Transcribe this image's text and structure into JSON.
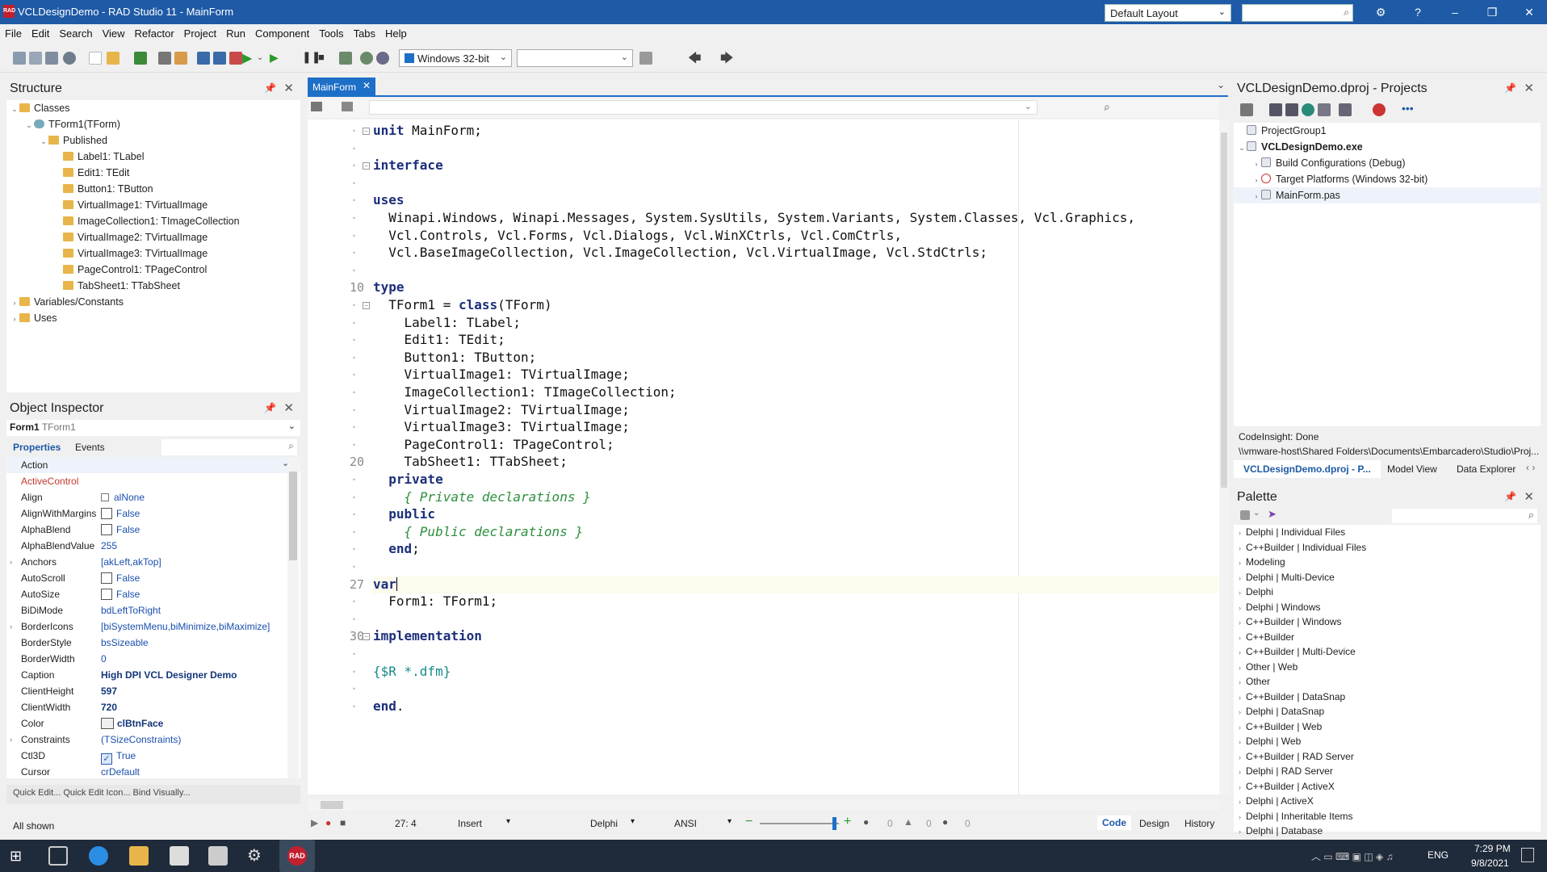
{
  "window": {
    "title": "VCLDesignDemo - RAD Studio 11 - MainForm",
    "logo_text": "RAD",
    "layout": "Default Layout"
  },
  "menu": [
    "File",
    "Edit",
    "Search",
    "View",
    "Refactor",
    "Project",
    "Run",
    "Component",
    "Tools",
    "Tabs",
    "Help"
  ],
  "toolbar": {
    "platform": "Windows 32-bit"
  },
  "structure": {
    "title": "Structure",
    "nodes": [
      {
        "label": "Classes",
        "depth": 0,
        "exp": "⌄"
      },
      {
        "label": "TForm1(TForm)",
        "depth": 1,
        "exp": "⌄"
      },
      {
        "label": "Published",
        "depth": 2,
        "exp": "⌄"
      },
      {
        "label": "Label1: TLabel",
        "depth": 3,
        "exp": ""
      },
      {
        "label": "Edit1: TEdit",
        "depth": 3,
        "exp": ""
      },
      {
        "label": "Button1: TButton",
        "depth": 3,
        "exp": ""
      },
      {
        "label": "VirtualImage1: TVirtualImage",
        "depth": 3,
        "exp": ""
      },
      {
        "label": "ImageCollection1: TImageCollection",
        "depth": 3,
        "exp": ""
      },
      {
        "label": "VirtualImage2: TVirtualImage",
        "depth": 3,
        "exp": ""
      },
      {
        "label": "VirtualImage3: TVirtualImage",
        "depth": 3,
        "exp": ""
      },
      {
        "label": "PageControl1: TPageControl",
        "depth": 3,
        "exp": ""
      },
      {
        "label": "TabSheet1: TTabSheet",
        "depth": 3,
        "exp": ""
      },
      {
        "label": "Variables/Constants",
        "depth": 0,
        "exp": "›"
      },
      {
        "label": "Uses",
        "depth": 0,
        "exp": "›"
      }
    ]
  },
  "inspector": {
    "title": "Object Inspector",
    "object_name": "Form1",
    "object_type": "TForm1",
    "tabs": [
      "Properties",
      "Events"
    ],
    "props": [
      {
        "name": "Action",
        "value": "",
        "kind": "text"
      },
      {
        "name": "ActiveControl",
        "value": "",
        "kind": "text",
        "red": true
      },
      {
        "name": "Align",
        "value": "alNone",
        "kind": "text"
      },
      {
        "name": "AlignWithMargins",
        "value": "False",
        "kind": "cb"
      },
      {
        "name": "AlphaBlend",
        "value": "False",
        "kind": "cb"
      },
      {
        "name": "AlphaBlendValue",
        "value": "255",
        "kind": "text"
      },
      {
        "name": "Anchors",
        "value": "[akLeft,akTop]",
        "kind": "text",
        "arrow": true
      },
      {
        "name": "AutoScroll",
        "value": "False",
        "kind": "cb"
      },
      {
        "name": "AutoSize",
        "value": "False",
        "kind": "cb"
      },
      {
        "name": "BiDiMode",
        "value": "bdLeftToRight",
        "kind": "text"
      },
      {
        "name": "BorderIcons",
        "value": "[biSystemMenu,biMinimize,biMaximize]",
        "kind": "text",
        "arrow": true
      },
      {
        "name": "BorderStyle",
        "value": "bsSizeable",
        "kind": "text"
      },
      {
        "name": "BorderWidth",
        "value": "0",
        "kind": "text"
      },
      {
        "name": "Caption",
        "value": "High DPI VCL Designer Demo",
        "kind": "bold"
      },
      {
        "name": "ClientHeight",
        "value": "597",
        "kind": "bold"
      },
      {
        "name": "ClientWidth",
        "value": "720",
        "kind": "bold"
      },
      {
        "name": "Color",
        "value": "clBtnFace",
        "kind": "color"
      },
      {
        "name": "Constraints",
        "value": "(TSizeConstraints)",
        "kind": "text",
        "arrow": true
      },
      {
        "name": "Ctl3D",
        "value": "True",
        "kind": "cbchk"
      },
      {
        "name": "Cursor",
        "value": "crDefault",
        "kind": "text"
      }
    ],
    "quick_edit": "Quick Edit... Quick Edit Icon... Bind Visually...",
    "all_shown": "All shown"
  },
  "editor": {
    "tab": "MainForm",
    "lines": [
      {
        "n": "",
        "html": "<span class='kw'>unit</span> MainForm;",
        "fold": "⊟"
      },
      {
        "n": "",
        "html": ""
      },
      {
        "n": "",
        "html": "<span class='kw'>interface</span>",
        "fold": "⊟"
      },
      {
        "n": "",
        "html": ""
      },
      {
        "n": "",
        "html": "<span class='kw'>uses</span>"
      },
      {
        "n": "",
        "html": "  Winapi.Windows, Winapi.Messages, System.SysUtils, System.Variants, System.Classes, Vcl.Graphics,"
      },
      {
        "n": "",
        "html": "  Vcl.Controls, Vcl.Forms, Vcl.Dialogs, Vcl.WinXCtrls, Vcl.ComCtrls,"
      },
      {
        "n": "",
        "html": "  Vcl.BaseImageCollection, Vcl.ImageCollection, Vcl.VirtualImage, Vcl.StdCtrls;"
      },
      {
        "n": "",
        "html": ""
      },
      {
        "n": "10",
        "html": "<span class='kw'>type</span>"
      },
      {
        "n": "",
        "html": "  TForm1 = <span class='kw'>class</span>(TForm)",
        "fold": "⊟"
      },
      {
        "n": "",
        "html": "    Label1: TLabel;"
      },
      {
        "n": "",
        "html": "    Edit1: TEdit;"
      },
      {
        "n": "",
        "html": "    Button1: TButton;"
      },
      {
        "n": "",
        "html": "    VirtualImage1: TVirtualImage;"
      },
      {
        "n": "",
        "html": "    ImageCollection1: TImageCollection;"
      },
      {
        "n": "",
        "html": "    VirtualImage2: TVirtualImage;"
      },
      {
        "n": "",
        "html": "    VirtualImage3: TVirtualImage;"
      },
      {
        "n": "",
        "html": "    PageControl1: TPageControl;"
      },
      {
        "n": "20",
        "html": "    TabSheet1: TTabSheet;"
      },
      {
        "n": "",
        "html": "  <span class='kw'>private</span>"
      },
      {
        "n": "",
        "html": "    <span class='cm'>{ Private declarations }</span>"
      },
      {
        "n": "",
        "html": "  <span class='kw'>public</span>"
      },
      {
        "n": "",
        "html": "    <span class='cm'>{ Public declarations }</span>"
      },
      {
        "n": "",
        "html": "  <span class='kw'>end</span>;"
      },
      {
        "n": "",
        "html": ""
      },
      {
        "n": "27",
        "html": "<span class='kw'>var</span>",
        "cur": true
      },
      {
        "n": "",
        "html": "  Form1: TForm1;"
      },
      {
        "n": "",
        "html": ""
      },
      {
        "n": "30",
        "html": "<span class='kw'>implementation</span>",
        "fold": "⊟"
      },
      {
        "n": "",
        "html": ""
      },
      {
        "n": "",
        "html": "<span class='dr'>{$R *.dfm}</span>"
      },
      {
        "n": "",
        "html": ""
      },
      {
        "n": "",
        "html": "<span class='kw'>end</span>."
      }
    ],
    "status": {
      "pos": "27:  4",
      "mode": "Insert",
      "lang": "Delphi",
      "enc": "ANSI",
      "c1": "0",
      "c2": "0",
      "c3": "0"
    },
    "views": [
      "Code",
      "Design",
      "History"
    ]
  },
  "projects": {
    "title": "VCLDesignDemo.dproj - Projects",
    "nodes": [
      {
        "label": "ProjectGroup1",
        "depth": 0,
        "exp": "",
        "bold": false
      },
      {
        "label": "VCLDesignDemo.exe",
        "depth": 0,
        "exp": "⌄",
        "bold": true
      },
      {
        "label": "Build Configurations (Debug)",
        "depth": 1,
        "exp": "›",
        "bold": false
      },
      {
        "label": "Target Platforms (Windows 32-bit)",
        "depth": 1,
        "exp": "›",
        "bold": false
      },
      {
        "label": "MainForm.pas",
        "depth": 1,
        "exp": "›",
        "bold": false
      }
    ],
    "codeinsight": "CodeInsight: Done",
    "path": "\\\\vmware-host\\Shared Folders\\Documents\\Embarcadero\\Studio\\Proj...",
    "tabs": [
      "VCLDesignDemo.dproj - P...",
      "Model View",
      "Data Explorer"
    ]
  },
  "palette": {
    "title": "Palette",
    "items": [
      "Delphi | Individual Files",
      "C++Builder | Individual Files",
      "Modeling",
      "Delphi | Multi-Device",
      "Delphi",
      "Delphi | Windows",
      "C++Builder | Windows",
      "C++Builder",
      "C++Builder | Multi-Device",
      "Other | Web",
      "Other",
      "C++Builder | DataSnap",
      "Delphi | DataSnap",
      "C++Builder | Web",
      "Delphi | Web",
      "C++Builder | RAD Server",
      "Delphi | RAD Server",
      "C++Builder | ActiveX",
      "Delphi | ActiveX",
      "Delphi | Inheritable Items",
      "Delphi | Database"
    ]
  },
  "taskbar": {
    "lang": "ENG",
    "time": "7:29 PM",
    "date": "9/8/2021",
    "rad": "RAD"
  },
  "colors": {
    "title_bg": "#1e5aa6",
    "keyword": "#1c2f7a",
    "comment": "#2c8f3e",
    "directive": "#168a8a",
    "tab_active": "#1e6fc7"
  }
}
